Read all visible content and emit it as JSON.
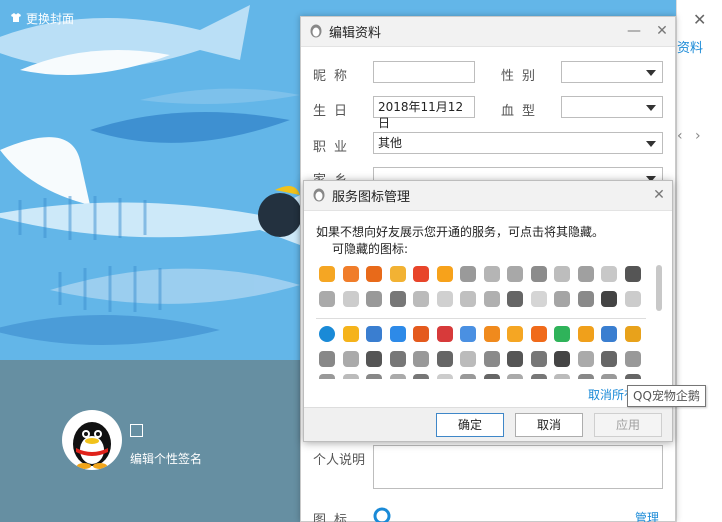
{
  "profile": {
    "change_cover": "更换封面",
    "nickname_box": "",
    "edit_signature": "编辑个性签名"
  },
  "right_panel": {
    "link_partial": "资料",
    "close": "✕",
    "chev_left": "‹",
    "chev_right": "›"
  },
  "edit_dialog": {
    "title": "编辑资料",
    "minimize": "—",
    "close": "✕",
    "fields": {
      "nickname_label": "昵称",
      "nickname_value": "",
      "gender_label": "性别",
      "gender_value": "",
      "birthday_label": "生日",
      "birthday_value": "2018年11月12日",
      "blood_label": "血型",
      "blood_value": "",
      "job_label": "职业",
      "job_value": "其他",
      "hometown_label": "家乡",
      "personal_desc_label": "个人说明",
      "icon_label": "图标"
    },
    "manage_link": "管理"
  },
  "service_dialog": {
    "title": "服务图标管理",
    "close": "✕",
    "description": "如果不想向好友展示您开通的服务，可点击将其隐藏。",
    "hidden_icons_label": "可隐藏的图标:",
    "cancel_all_partial": "取消所有",
    "buttons": {
      "ok": "确定",
      "cancel": "取消",
      "apply": "应用"
    }
  },
  "tooltip": "QQ宠物企鹅",
  "colors": {
    "cover_blue": "#5fb3e6",
    "bottom_gray": "#668fa2",
    "link_blue": "#1a8ad7",
    "accent_border": "#3f87c8"
  }
}
